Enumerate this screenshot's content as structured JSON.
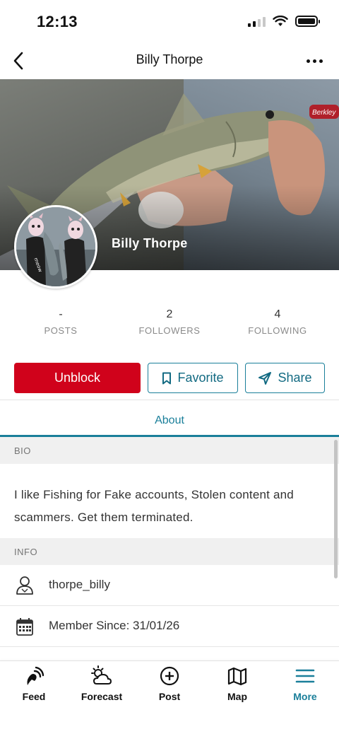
{
  "status_bar": {
    "time": "12:13"
  },
  "header": {
    "title": "Billy Thorpe"
  },
  "profile": {
    "name": "Billy Thorpe"
  },
  "stats": [
    {
      "value": "-",
      "label": "POSTS"
    },
    {
      "value": "2",
      "label": "FOLLOWERS"
    },
    {
      "value": "4",
      "label": "FOLLOWING"
    }
  ],
  "actions": {
    "unblock": "Unblock",
    "favorite": "Favorite",
    "share": "Share"
  },
  "tabs": {
    "about": "About"
  },
  "bio": {
    "header": "BIO",
    "text": "I like Fishing for Fake accounts, Stolen content and scammers. Get them terminated."
  },
  "info": {
    "header": "INFO",
    "username": "thorpe_billy",
    "member_since": "Member Since: 31/01/26"
  },
  "tabbar": [
    {
      "label": "Feed",
      "icon": "feed-icon"
    },
    {
      "label": "Forecast",
      "icon": "forecast-icon"
    },
    {
      "label": "Post",
      "icon": "post-icon"
    },
    {
      "label": "Map",
      "icon": "map-icon"
    },
    {
      "label": "More",
      "icon": "menu-icon",
      "active": true
    }
  ],
  "colors": {
    "accent": "#1a7f9a",
    "unblock": "#d0021b"
  }
}
